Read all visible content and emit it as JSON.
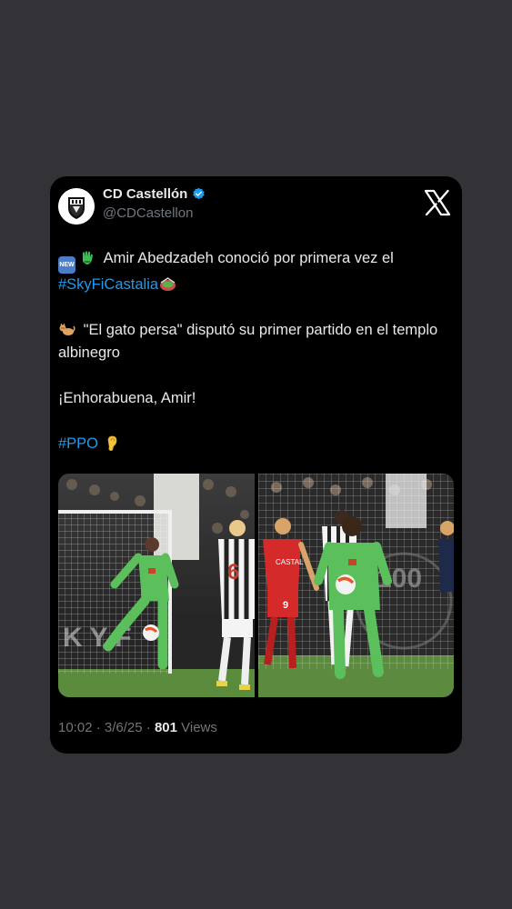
{
  "tweet": {
    "display_name": "CD Castellón",
    "handle": "@CDCastellon",
    "icons": {
      "verified": "verified-badge-icon",
      "platform": "x-logo-icon",
      "new": "new-emoji-icon",
      "glove": "goalkeeper-glove-emoji-icon",
      "stadium": "stadium-emoji-icon",
      "cat": "cat-emoji-icon",
      "ear": "ear-emoji-icon"
    },
    "line1_text": " Amir Abedzadeh conoció por primera vez el",
    "hashtag1": "#SkyFiCastalia",
    "line2_text": " \"El gato persa\" disputó su primer partido en el templo albinegro",
    "line3_text": "¡Enhorabuena, Amir!",
    "hashtag2": "#PPO",
    "new_badge": "NEW",
    "time": "10:02",
    "separator": " · ",
    "date": "3/6/25",
    "views_count": "801",
    "views_label": " Views",
    "photo2_jersey": "CASTAL"
  },
  "colors": {
    "background": "#333236",
    "card": "#000000",
    "text": "#e7e9ea",
    "secondary": "#71767b",
    "link": "#1d9bf0",
    "verified": "#1d9bf0",
    "keeper_kit": "#5bbf5c",
    "home_kit": "#ffffff",
    "away_kit": "#d42a2a"
  }
}
